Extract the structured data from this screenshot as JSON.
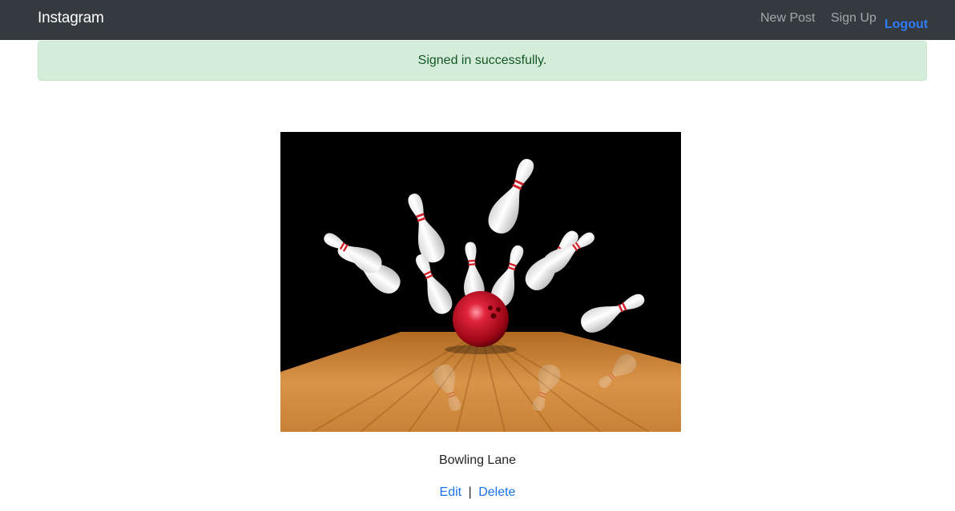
{
  "navbar": {
    "brand": "Instagram",
    "new_post": "New Post",
    "sign_up": "Sign Up",
    "logout": "Logout"
  },
  "flash": {
    "message": "Signed in successfully."
  },
  "post": {
    "caption": "Bowling Lane",
    "edit_label": "Edit",
    "separator": "|",
    "delete_label": "Delete"
  },
  "colors": {
    "navbar_bg": "#343a40",
    "alert_bg": "#d4edda",
    "alert_text": "#155724",
    "link": "#1a73e8",
    "ball": "#c8102e"
  }
}
